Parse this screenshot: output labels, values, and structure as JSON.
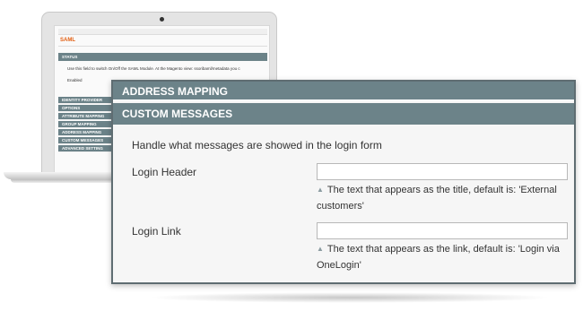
{
  "laptop": {
    "screen": {
      "page_title": "SAML",
      "status_header": "STATUS",
      "status_description": "Use this field to switch On/Off the SAML Module. At the Magento view: ssoribaml/metadata you c",
      "status_value": "Enabled",
      "sections": [
        "IDENTITY PROVIDER",
        "OPTIONS",
        "ATTRIBUTE MAPPING",
        "GROUP MAPPING",
        "ADDRESS MAPPING",
        "CUSTOM MESSAGES",
        "ADVANCED SETTING"
      ]
    }
  },
  "panel": {
    "address_mapping_header": "ADDRESS MAPPING",
    "custom_messages_header": "CUSTOM MESSAGES",
    "intro": "Handle what messages are showed in the login form",
    "fields": [
      {
        "label": "Login Header",
        "value": "",
        "hint": "The text that appears as the title, default is: 'External customers'"
      },
      {
        "label": "Login Link",
        "value": "",
        "hint": "The text that appears as the link, default is: 'Login via OneLogin'"
      }
    ],
    "hint_icon": "triangle-up-icon"
  },
  "colors": {
    "section_header": "#6c8389",
    "panel_border": "#5f6d72",
    "title_accent": "#e25f12"
  }
}
